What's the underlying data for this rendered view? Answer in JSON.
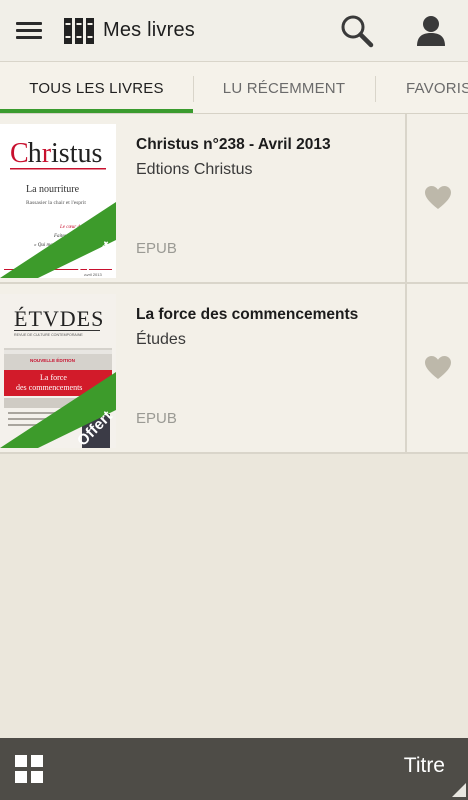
{
  "appbar": {
    "title": "Mes livres",
    "icons": [
      "menu-icon",
      "library-icon",
      "search-icon",
      "account-icon"
    ]
  },
  "tabs": [
    {
      "label": "TOUS LES LIVRES",
      "active": true
    },
    {
      "label": "LU RÉCEMMENT",
      "active": false
    },
    {
      "label": "FAVORIS",
      "active": false
    }
  ],
  "books": [
    {
      "title": "Christus n°238 - Avril 2013",
      "author": "Edtions Christus",
      "format": "EPUB",
      "badge": "Offert",
      "cover": {
        "masthead": "Christus",
        "headline": "La nourriture",
        "subline": "Rassasier la chair et l'esprit",
        "issue": "n° 238",
        "date": "Avril 2013"
      }
    },
    {
      "title": "La force des commencements",
      "author": "Études",
      "format": "EPUB",
      "badge": "Offert",
      "cover": {
        "masthead": "ÉTVDES",
        "tagline": "REVUE DE CULTURE CONTEMPORAINE",
        "edition": "NOUVELLE ÉDITION",
        "headline_1": "La force",
        "headline_2": "des commencements"
      }
    }
  ],
  "bottombar": {
    "sort_label": "Titre",
    "icons": [
      "grid-view-icon",
      "sort-corner-icon"
    ]
  },
  "colors": {
    "accent": "#3a9b2e",
    "background": "#ebe7dc",
    "bottombar": "#4e4c47"
  }
}
